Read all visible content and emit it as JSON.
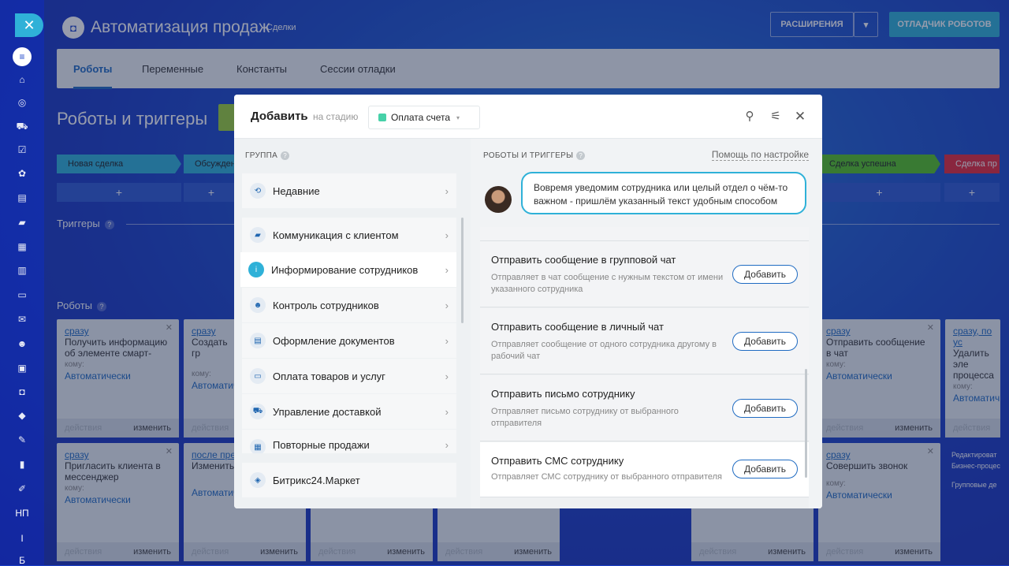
{
  "colors": {
    "accent": "#1f6bc2",
    "cyan": "#2fb1d8",
    "stage_green": "#47d1a8"
  },
  "header": {
    "title": "Автоматизация продаж",
    "subtitle": "Сделки",
    "extensions_label": "РАСШИРЕНИЯ",
    "debugger_label": "ОТЛАДЧИК РОБОТОВ"
  },
  "tabs": [
    "Роботы",
    "Переменные",
    "Константы",
    "Сессии отладки"
  ],
  "page_title": "Роботы и триггеры",
  "stages": {
    "first": "Новая сделка",
    "second": "Обсужден",
    "success": "Сделка успешна",
    "fail": "Сделка пр"
  },
  "plus": "+",
  "sections": {
    "triggers": "Триггеры",
    "robots": "Роботы"
  },
  "sidebar_texts": {
    "np": "НП",
    "i": "I",
    "b": "Б"
  },
  "cards": {
    "c1": {
      "when": "сразу",
      "text": "Получить информацию об элементе смарт-",
      "kom": "кому:",
      "auto": "Автоматически",
      "a": "действия",
      "b": "изменить"
    },
    "c2": {
      "when": "сразу",
      "text": "Создать гр",
      "kom": "кому:",
      "auto": "Автоматич",
      "a": "действия",
      "b": "изменить"
    },
    "c3": {
      "when": "сразу",
      "text": "Пригласить клиента в мессенджер",
      "kom": "кому:",
      "auto": "Автоматически",
      "a": "действия",
      "b": "изменить"
    },
    "c4": {
      "when": "после пре",
      "text": "Изменить",
      "kom": "",
      "auto": "Автоматич",
      "a": "действия",
      "b": "изменить"
    },
    "c5": {
      "auto": "Автоматически",
      "a": "действия",
      "b": "изменить"
    },
    "c6": {
      "auto": "Автоматически",
      "a": "действия",
      "b": "изменить"
    },
    "c7": {
      "auto": "Автоматически",
      "a": "действия",
      "b": "изменить"
    },
    "r1": {
      "when": "сразу",
      "text": "Отправить сообщение в чат",
      "kom": "кому:",
      "auto": "Автоматически",
      "a": "действия",
      "b": "изменить"
    },
    "r2": {
      "when": "сразу, по ус",
      "text": "Удалить эле процесса",
      "kom": "кому:",
      "auto": "Автоматич",
      "a": "действия"
    },
    "r3": {
      "when": "сразу",
      "text": "Совершить звонок",
      "kom": "кому:",
      "auto": "Автоматически",
      "a": "действия",
      "b": "изменить"
    },
    "r4": {
      "a": "действия",
      "b": "изменить"
    },
    "r4_links": [
      "Редактироват",
      "Бизнес-процес",
      "Групповые де"
    ]
  },
  "modal": {
    "title": "Добавить",
    "on_stage": "на стадию",
    "stage_value": "Оплата счета",
    "group_header": "ГРУППА",
    "robots_header": "РОБОТЫ И ТРИГГЕРЫ",
    "help_link": "Помощь по настройке",
    "bubble": "Вовремя уведомим сотрудника или целый отдел о чём-то важном - пришлём указанный текст удобным способом",
    "groups": [
      "Недавние",
      "Коммуникация с клиентом",
      "Информирование сотрудников",
      "Контроль сотрудников",
      "Оформление документов",
      "Оплата товаров и услуг",
      "Управление доставкой",
      "Повторные продажи",
      "Битрикс24.Маркет"
    ],
    "robots": [
      {
        "title": "Отправить сообщение в групповой чат",
        "desc": "Отправляет в чат сообщение с нужным текстом от имени указанного сотрудника",
        "btn": "Добавить"
      },
      {
        "title": "Отправить сообщение в личный чат",
        "desc": "Отправляет сообщение от одного сотрудника другому в рабочий чат",
        "btn": "Добавить"
      },
      {
        "title": "Отправить письмо сотруднику",
        "desc": "Отправляет письмо сотруднику от выбранного отправителя",
        "btn": "Добавить"
      },
      {
        "title": "Отправить СМС сотруднику",
        "desc": "Отправляет СМС сотруднику от выбранного отправителя",
        "btn": "Добавить"
      }
    ]
  }
}
